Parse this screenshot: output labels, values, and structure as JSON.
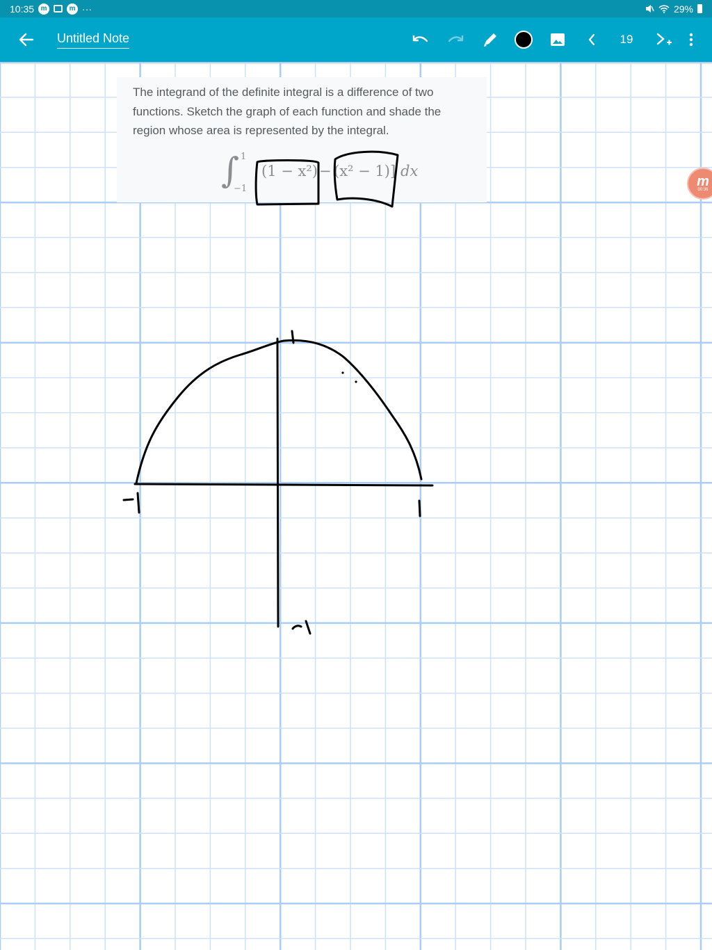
{
  "status_bar": {
    "time": "10:35",
    "app_badge": "m",
    "more": "···",
    "battery": "29%"
  },
  "toolbar": {
    "title": "Untitled Note",
    "page_number": "19",
    "icons": [
      "back-arrow-icon",
      "undo-icon",
      "redo-icon",
      "pen-icon",
      "color-circle-icon",
      "image-icon",
      "chevron-left-icon",
      "add-page-icon",
      "more-vertical-icon"
    ]
  },
  "question": {
    "text_line1": "The integrand of the definite integral is a difference of two",
    "text_line2": "functions. Sketch the graph of each function and shade the",
    "text_line3": "region whose area is represented by the integral.",
    "integral_symbol": "∫",
    "upper_limit": "1",
    "lower_limit": "−1",
    "term1": "(1 − x²)",
    "minus": "−",
    "term2": "(x² − 1)]",
    "differential": "dx"
  },
  "recording_badge": {
    "letter": "m",
    "time": "00:36"
  },
  "colors": {
    "status_bar": "#0892ad",
    "toolbar": "#00a6c9",
    "grid_minor": "#cfe1f7",
    "grid_major": "#a9cdf3",
    "ink": "#000000",
    "badge": "#ef8a72"
  }
}
